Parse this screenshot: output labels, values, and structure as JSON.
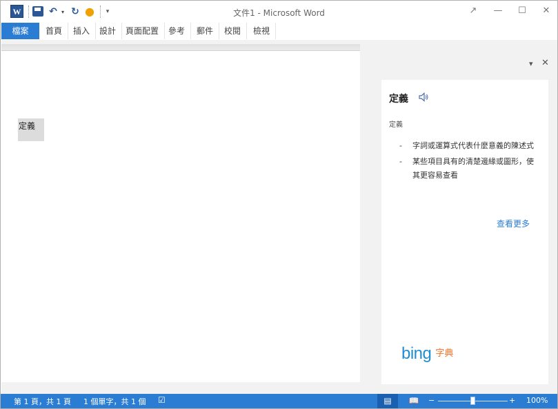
{
  "window": {
    "title": "文件1 - Microsoft Word",
    "app_icon_label": "W",
    "controls": [
      "↗",
      "—",
      "☐",
      "✕"
    ]
  },
  "qat": {
    "save_icon": "save-icon",
    "undo_icon": "↶",
    "dropdown_glyph": "▾",
    "redo_icon": "↻",
    "touch_icon": "●",
    "customize_glyph": "▾"
  },
  "ribbon": {
    "file_tab": "檔案",
    "tabs": [
      "首頁",
      "插入",
      "設計",
      "頁面配置",
      "參考",
      "郵件",
      "校閱",
      "檢視"
    ]
  },
  "document": {
    "selected_text": "定義"
  },
  "pane": {
    "dropdown_glyph": "▾",
    "close_glyph": "✕",
    "word": "定義",
    "part_label": "定義",
    "definitions": [
      "字詞或運算式代表什麼意義的陳述式",
      "某些項目具有的清楚邊緣或圖形，使其更容易查看"
    ],
    "dash": "-",
    "see_more": "查看更多",
    "brand": "bing",
    "brand_suffix": "字典"
  },
  "status": {
    "page": "第 1 頁，共 1 頁",
    "words": "1 個單字，共 1 個",
    "proofing_icon": "☑",
    "view_print_icon": "▤",
    "view_read_icon": "📖",
    "zoom_minus": "−",
    "zoom_plus": "+",
    "zoom": "100%",
    "zoom_fraction": 0.5
  },
  "colors": {
    "accent": "#2b7cd3",
    "brand_blue": "#1f8ed0",
    "brand_orange": "#f26f21"
  }
}
